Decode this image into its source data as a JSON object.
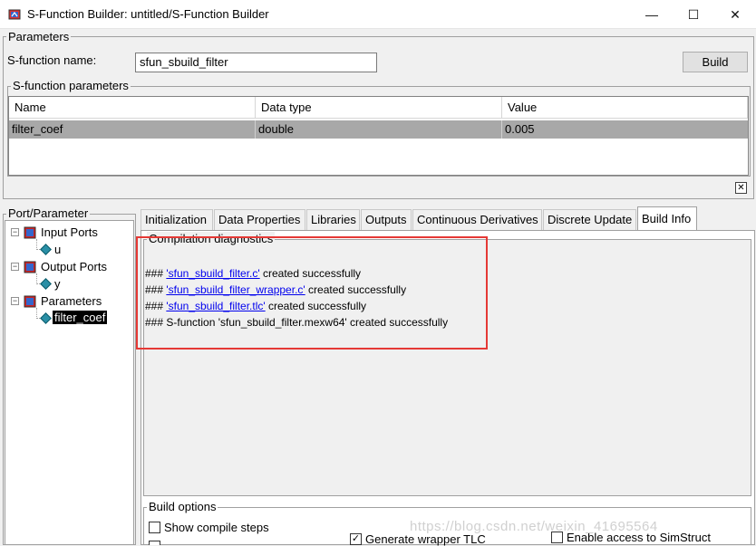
{
  "window": {
    "title": "S-Function Builder: untitled/S-Function Builder",
    "minimize_glyph": "—",
    "maximize_glyph": "☐",
    "close_glyph": "✕"
  },
  "parameters_group": {
    "label": "Parameters",
    "sfunction_name_label": "S-function name:",
    "sfunction_name_value": "sfun_sbuild_filter",
    "build_button": "Build"
  },
  "sfunction_parameters": {
    "label": "S-function parameters",
    "columns": [
      "Name",
      "Data type",
      "Value"
    ],
    "rows": [
      [
        "filter_coef",
        "double",
        "0.005"
      ]
    ],
    "delete_glyph": "✕"
  },
  "port_parameter": {
    "label": "Port/Parameter",
    "tree": {
      "input_ports": {
        "label": "Input Ports",
        "children": [
          "u"
        ]
      },
      "output_ports": {
        "label": "Output Ports",
        "children": [
          "y"
        ]
      },
      "parameters": {
        "label": "Parameters",
        "children": [
          "filter_coef"
        ]
      },
      "expander_glyph": "−"
    }
  },
  "tabs": [
    "Initialization",
    "Data Properties",
    "Libraries",
    "Outputs",
    "Continuous Derivatives",
    "Discrete Update",
    "Build Info"
  ],
  "active_tab": "Build Info",
  "build_info": {
    "diagnostics_label": "Compilation diagnostics",
    "lines": [
      {
        "prefix": "### ",
        "link": "'sfun_sbuild_filter.c'",
        "suffix": " created successfully"
      },
      {
        "prefix": "### ",
        "link": "'sfun_sbuild_filter_wrapper.c'",
        "suffix": " created successfully"
      },
      {
        "prefix": "### ",
        "link": "'sfun_sbuild_filter.tlc'",
        "suffix": " created successfully"
      },
      {
        "prefix": "### ",
        "link": "",
        "suffix": "S-function 'sfun_sbuild_filter.mexw64' created successfully"
      }
    ]
  },
  "build_options": {
    "label": "Build options",
    "show_compile_steps": {
      "label": "Show compile steps",
      "checked": false,
      "glyph": ""
    },
    "generate_wrapper_tlc": {
      "label": "Generate wrapper TLC",
      "checked": true,
      "glyph": "✓"
    },
    "enable_simstruct": {
      "label": "Enable access to SimStruct",
      "checked": false,
      "glyph": ""
    }
  },
  "watermark": "https://blog.csdn.net/weixin_41695564",
  "colors": {
    "highlight_red": "#e53935",
    "selected_row": "#a8a8a8",
    "link_blue": "#0000ee",
    "tree_selection": "#000000"
  }
}
